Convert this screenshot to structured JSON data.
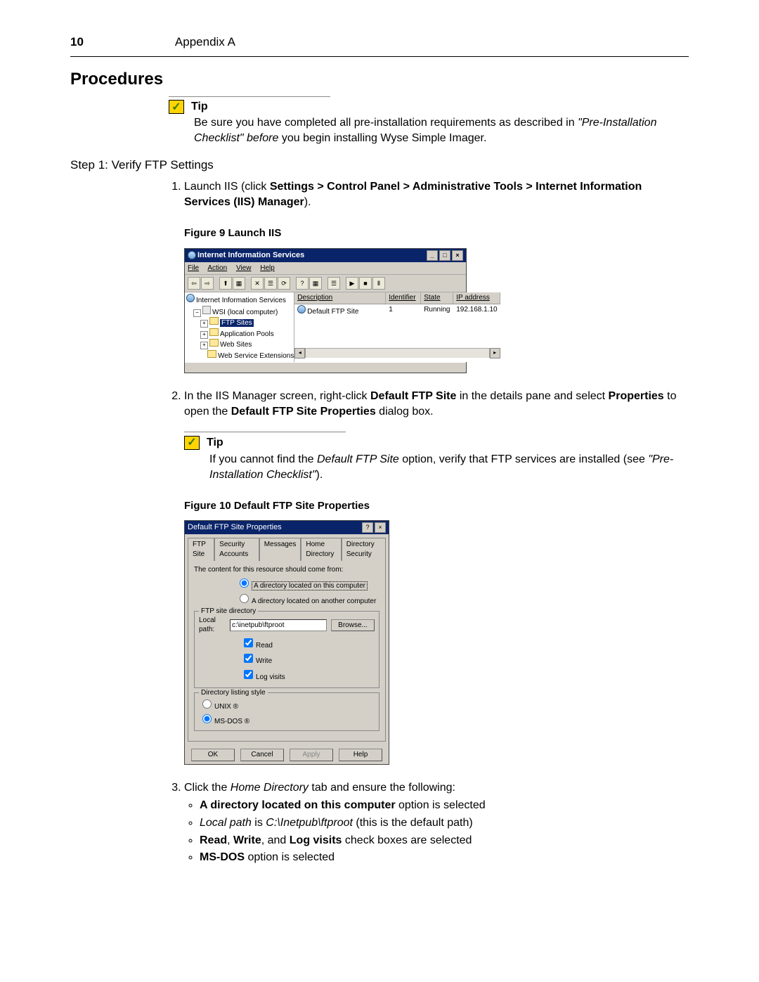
{
  "header": {
    "page_number": "10",
    "appendix": "Appendix A"
  },
  "section_title": "Procedures",
  "tip1": {
    "label": "Tip",
    "line1": "Be sure you have completed all pre-installation requirements as described in ",
    "italic": "\"Pre-Installation Checklist\" before",
    "line2": " you begin installing Wyse Simple Imager."
  },
  "step_heading": "Step 1: Verify FTP Settings",
  "proc1": {
    "prefix": "Launch IIS (click ",
    "bold1": "Settings > Control Panel > Administrative Tools > Internet Information Services (IIS) Manager",
    "suffix": ")."
  },
  "fig9_caption": "Figure 9    Launch IIS",
  "iis": {
    "title": "Internet Information Services",
    "menu": {
      "file": "File",
      "action": "Action",
      "view": "View",
      "help": "Help"
    },
    "tree": {
      "root": "Internet Information Services",
      "computer": "WSI (local computer)",
      "ftpsites": "FTP Sites",
      "apppools": "Application Pools",
      "websites": "Web Sites",
      "webext": "Web Service Extensions"
    },
    "columns": {
      "desc": "Description",
      "id": "Identifier",
      "state": "State",
      "ip": "IP address"
    },
    "row": {
      "desc": "Default FTP Site",
      "id": "1",
      "state": "Running",
      "ip": "192.168.1.10"
    }
  },
  "proc2": {
    "prefix": "In the IIS Manager screen, right-click ",
    "bold1": "Default FTP Site",
    "mid1": " in the details pane and select ",
    "bold2": "Properties",
    "mid2": " to open the ",
    "bold3": "Default FTP Site Properties",
    "suffix": " dialog box."
  },
  "tip2": {
    "label": "Tip",
    "prefix": "If you cannot find the ",
    "italic1": "Default FTP Site",
    "mid": " option, verify that FTP services are installed (see ",
    "italic2": "\"Pre-Installation Checklist\"",
    "suffix": ")."
  },
  "fig10_caption": "Figure 10    Default FTP Site Properties",
  "dlg": {
    "title": "Default FTP Site Properties",
    "tabs": {
      "ftp": "FTP Site",
      "sec": "Security Accounts",
      "msg": "Messages",
      "home": "Home Directory",
      "dirsec": "Directory Security"
    },
    "content_from": "The content for this resource should come from:",
    "radio_local": "A directory located on this computer",
    "radio_remote": "A directory located on another computer",
    "grp_dir": "FTP site directory",
    "local_path_label": "Local path:",
    "local_path_value": "c:\\inetpub\\ftproot",
    "browse": "Browse...",
    "chk_read": "Read",
    "chk_write": "Write",
    "chk_log": "Log visits",
    "grp_style": "Directory listing style",
    "radio_unix": "UNIX ®",
    "radio_msdos": "MS-DOS ®",
    "btn_ok": "OK",
    "btn_cancel": "Cancel",
    "btn_apply": "Apply",
    "btn_help": "Help"
  },
  "proc3": {
    "prefix": "Click the ",
    "italic": "Home Directory",
    "suffix": " tab and ensure the following:"
  },
  "bullets": {
    "b1_bold": "A directory located on this computer",
    "b1_suffix": " option is selected",
    "b2_italic": "Local path",
    "b2_mid": " is ",
    "b2_italic2": "C:\\Inetpub\\ftproot",
    "b2_suffix": " (this is the default path)",
    "b3_bold1": "Read",
    "b3_sep1": ", ",
    "b3_bold2": "Write",
    "b3_sep2": ", and ",
    "b3_bold3": "Log visits",
    "b3_suffix": " check boxes are selected",
    "b4_bold": "MS-DOS",
    "b4_suffix": " option is selected"
  }
}
